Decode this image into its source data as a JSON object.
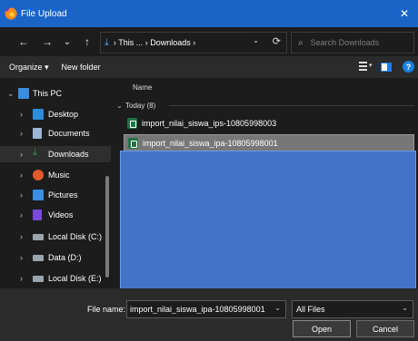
{
  "window": {
    "title": "File Upload",
    "close": "✕"
  },
  "nav": {
    "back": "←",
    "forward": "→",
    "history": "⌄",
    "up": "↑",
    "address": {
      "download_icon": "⤓",
      "path": "›  This ...  ›  Downloads  ›",
      "dropdown": "⌄",
      "refresh": "⟳"
    },
    "search": {
      "icon": "⌕",
      "placeholder": "Search Downloads"
    }
  },
  "toolbar": {
    "organize": "Organize ▾",
    "new_folder": "New folder",
    "view_drop": "▾",
    "help": "?"
  },
  "sidebar": {
    "items": [
      {
        "label": "This PC",
        "chevron": "⌄",
        "icon": "monitor-icon",
        "color": "#3a8de0"
      },
      {
        "label": "Desktop",
        "chevron": "›",
        "icon": "desktop-folder-icon",
        "color": "#2e8bd8"
      },
      {
        "label": "Documents",
        "chevron": "›",
        "icon": "document-icon",
        "color": "#9bb7d4"
      },
      {
        "label": "Downloads",
        "chevron": "›",
        "icon": "download-icon",
        "color": "#2ea043"
      },
      {
        "label": "Music",
        "chevron": "›",
        "icon": "music-icon",
        "color": "#e05a2b"
      },
      {
        "label": "Pictures",
        "chevron": "›",
        "icon": "pictures-icon",
        "color": "#3a8de0"
      },
      {
        "label": "Videos",
        "chevron": "›",
        "icon": "videos-icon",
        "color": "#7a4ad8"
      },
      {
        "label": "Local Disk (C:)",
        "chevron": "›",
        "icon": "drive-icon",
        "color": "#9aa4ad"
      },
      {
        "label": "Data (D:)",
        "chevron": "›",
        "icon": "drive-icon",
        "color": "#9aa4ad"
      },
      {
        "label": "Local Disk (E:)",
        "chevron": "›",
        "icon": "drive-icon",
        "color": "#9aa4ad"
      }
    ]
  },
  "files": {
    "column_name": "Name",
    "group": {
      "caret": "⌄",
      "label": "Today (8)"
    },
    "rows": [
      {
        "name": "import_nilai_siswa_ips-10805998003"
      },
      {
        "name": "import_nilai_siswa_ipa-10805998001"
      }
    ]
  },
  "footer": {
    "filename_label": "File name:",
    "filename_value": "import_nilai_siswa_ipa-10805998001",
    "filename_drop": "⌄",
    "filetype": "All Files",
    "filetype_drop": "⌄",
    "open": "Open",
    "cancel": "Cancel"
  }
}
